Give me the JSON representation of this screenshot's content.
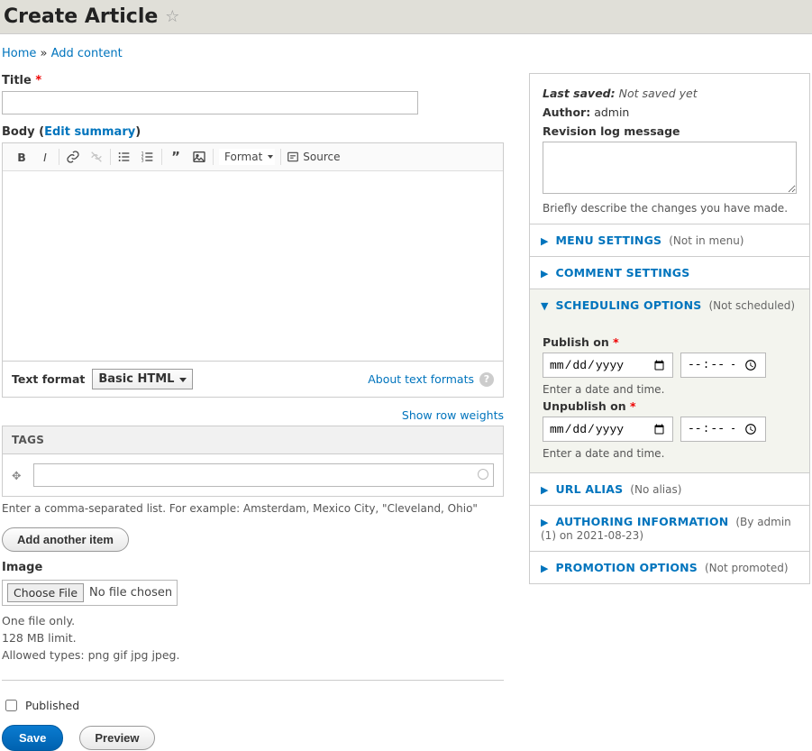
{
  "header": {
    "title": "Create Article"
  },
  "breadcrumb": {
    "home": "Home",
    "sep": " » ",
    "addcontent": "Add content"
  },
  "title_field": {
    "label": "Title",
    "value": ""
  },
  "body": {
    "label": "Body",
    "edit_summary": "Edit summary",
    "paren_open": " (",
    "paren_close": ")"
  },
  "toolbar": {
    "format": "Format",
    "source": "Source"
  },
  "textformat": {
    "label": "Text format",
    "selected": "Basic HTML",
    "about": "About text formats"
  },
  "rowweights": "Show row weights",
  "tags": {
    "header": "TAGS",
    "value": "",
    "hint": "Enter a comma-separated list. For example: Amsterdam, Mexico City, \"Cleveland, Ohio\"",
    "add": "Add another item"
  },
  "image": {
    "label": "Image",
    "choose": "Choose File",
    "nofile": "No file chosen",
    "h1": "One file only.",
    "h2": "128 MB limit.",
    "h3": "Allowed types: png gif jpg jpeg."
  },
  "published": "Published",
  "actions": {
    "save": "Save",
    "preview": "Preview"
  },
  "sidebar": {
    "lastsaved_label": "Last saved:",
    "lastsaved_val": "Not saved yet",
    "author_label": "Author:",
    "author_val": "admin",
    "revlog_label": "Revision log message",
    "revlog_hint": "Briefly describe the changes you have made.",
    "menu": {
      "lead": "MENU SETTINGS",
      "sub": "(Not in menu)"
    },
    "comments": {
      "lead": "COMMENT SETTINGS"
    },
    "sched": {
      "lead": "SCHEDULING OPTIONS",
      "sub": "(Not scheduled)",
      "publish_label": "Publish on",
      "date_ph": "mm/dd/yyyy",
      "time_ph": "--:-- --",
      "hint": "Enter a date and time.",
      "unpublish_label": "Unpublish on"
    },
    "url": {
      "lead": "URL ALIAS",
      "sub": "(No alias)"
    },
    "auth": {
      "lead": "AUTHORING INFORMATION",
      "sub": "(By admin (1) on 2021-08-23)"
    },
    "promo": {
      "lead": "PROMOTION OPTIONS",
      "sub": "(Not promoted)"
    }
  }
}
